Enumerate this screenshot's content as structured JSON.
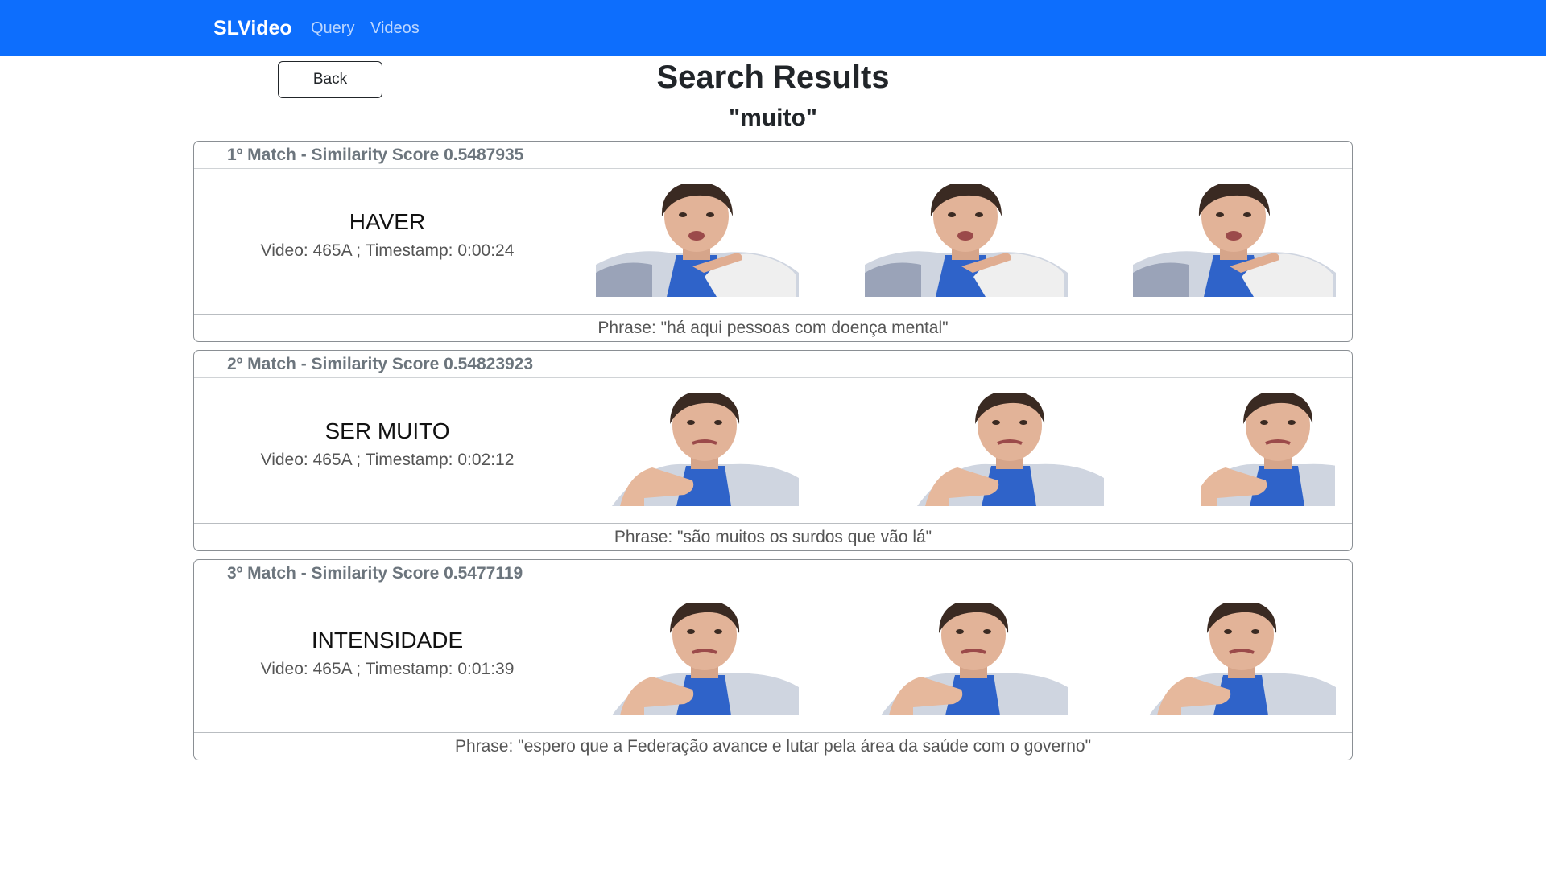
{
  "navbar": {
    "brand": "SLVideo",
    "links": [
      "Query",
      "Videos"
    ],
    "color": "#0d6efd"
  },
  "back_button": "Back",
  "page": {
    "title": "Search Results",
    "query": "\"muito\""
  },
  "results": [
    {
      "header": "1º Match - Similarity Score 0.5487935",
      "word": "HAVER",
      "meta": "Video: 465A ; Timestamp: 0:00:24",
      "phrase": "Phrase: \"há aqui pessoas com doença mental\""
    },
    {
      "header": "2º Match - Similarity Score 0.54823923",
      "word": "SER MUITO",
      "meta": "Video: 465A ; Timestamp: 0:02:12",
      "phrase": "Phrase: \"são muitos os surdos que vão lá\""
    },
    {
      "header": "3º Match - Similarity Score 0.5477119",
      "word": "INTENSIDADE",
      "meta": "Video: 465A ; Timestamp: 0:01:39",
      "phrase": "Phrase: \"espero que a Federação avance e lutar pela área da saúde com o governo\""
    }
  ]
}
